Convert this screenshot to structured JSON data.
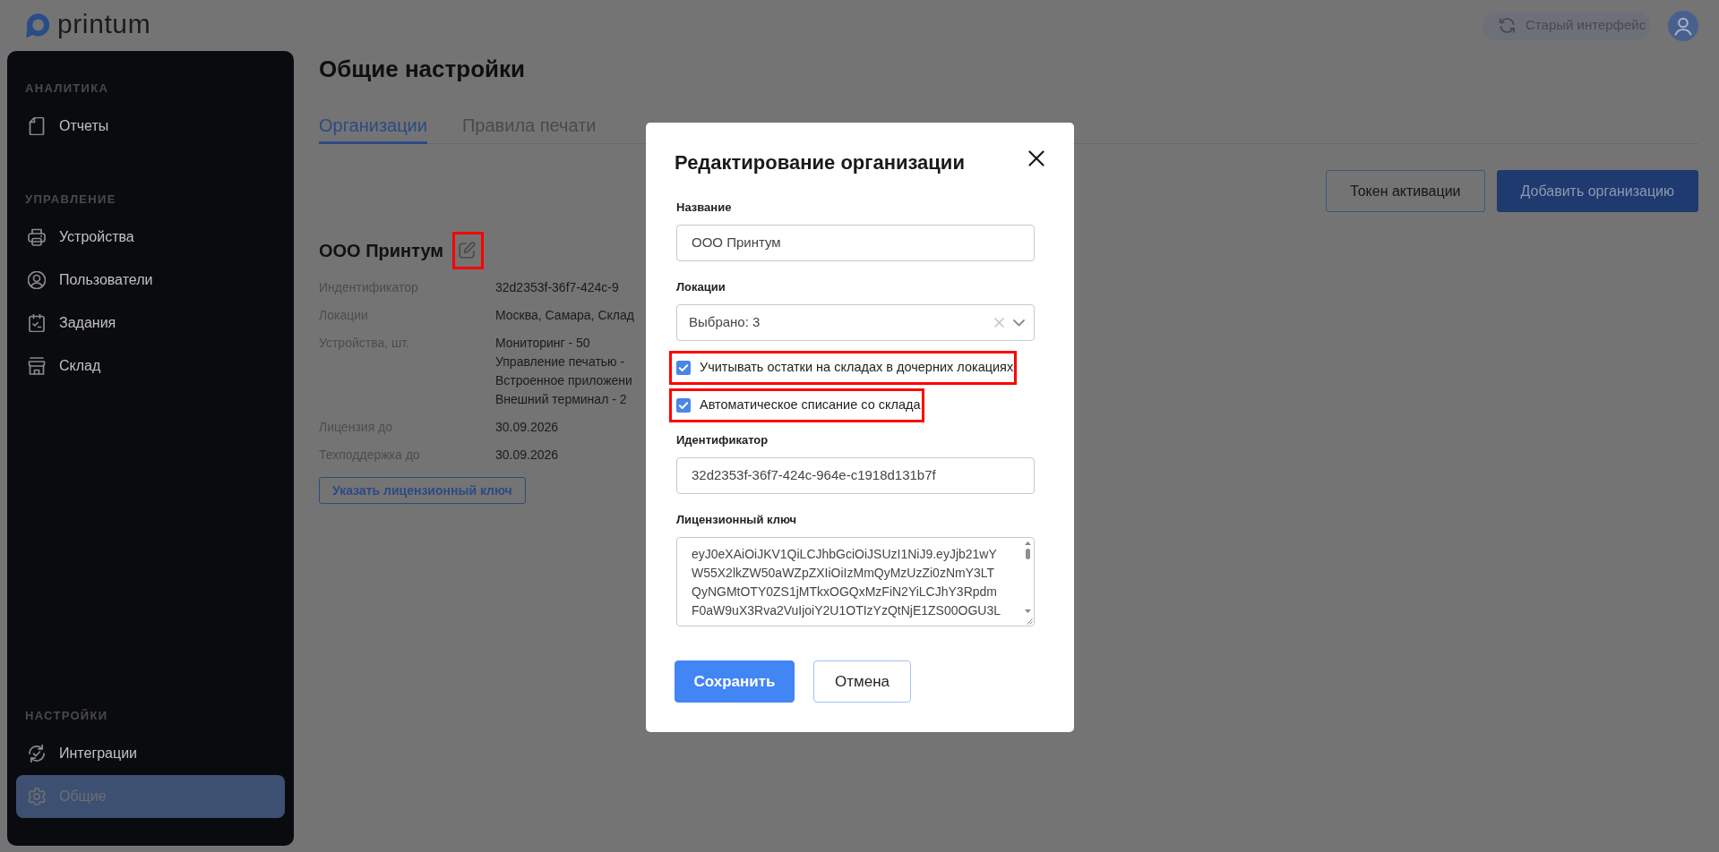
{
  "header": {
    "logo": "printum",
    "old_interface_button": "Старый интерфейс"
  },
  "sidebar": {
    "sections": [
      {
        "title": "АНАЛИТИКА",
        "items": [
          {
            "label": "Отчеты",
            "selected": false
          }
        ]
      },
      {
        "title": "УПРАВЛЕНИЕ",
        "items": [
          {
            "label": "Устройства",
            "selected": false
          },
          {
            "label": "Пользователи",
            "selected": false
          },
          {
            "label": "Задания",
            "selected": false
          },
          {
            "label": "Склад",
            "selected": false
          }
        ]
      },
      {
        "title": "НАСТРОЙКИ",
        "items": [
          {
            "label": "Интеграции",
            "selected": false
          },
          {
            "label": "Общие",
            "selected": true
          }
        ]
      }
    ]
  },
  "page": {
    "title": "Общие настройки",
    "tabs": [
      {
        "label": "Организации",
        "selected": true
      },
      {
        "label": "Правила печати",
        "selected": false
      }
    ],
    "actions": [
      {
        "label": "Токен активации",
        "kind": "outline"
      },
      {
        "label": "Добавить организацию",
        "kind": "primary"
      }
    ],
    "organization": {
      "name": "ООО Принтум",
      "edit_highlighted": true,
      "fields": [
        {
          "label": "Индентификатор",
          "values": [
            "32d2353f-36f7-424c-9"
          ]
        },
        {
          "label": "Локации",
          "values": [
            "Москва, Самара, Склад"
          ]
        },
        {
          "label": "Устройства, шт.",
          "values": [
            "Мониторинг - 50",
            "Управление печатью -",
            "Встроенное приложени",
            "Внешний терминал - 2"
          ]
        },
        {
          "label": "Лицензия до",
          "values": [
            "30.09.2026"
          ]
        },
        {
          "label": "Техподдержка до",
          "values": [
            "30.09.2026"
          ]
        }
      ],
      "license_button": "Указать лицензионный ключ"
    }
  },
  "dialog": {
    "title": "Редактирование организации",
    "name_field": {
      "label": "Название",
      "value": "ООО Принтум"
    },
    "locations_field": {
      "label": "Локации",
      "value": "Выбрано: 3"
    },
    "checkboxes": [
      {
        "label": "Учитывать остатки на складах в дочерних локациях",
        "checked": true,
        "highlighted": true
      },
      {
        "label": "Автоматическое списание со склада",
        "checked": true,
        "highlighted": true
      }
    ],
    "identifier_field": {
      "label": "Идентификатор",
      "value": "32d2353f-36f7-424c-964e-c1918d131b7f"
    },
    "license_field": {
      "label": "Лицензионный ключ",
      "value_lines": [
        "eyJ0eXAiOiJKV1QiLCJhbGciOiJSUzI1NiJ9.eyJjb21wY",
        "W55X2lkZW50aWZpZXIiOiIzMmQyMzUzZi0zNmY3LT",
        "QyNGMtOTY0ZS1jMTkxOGQxMzFiN2YiLCJhY3Rpdm",
        "F0aW9uX3Rva2VuIjoiY2U1OTIzYzQtNjE1ZS00OGU3L"
      ]
    },
    "buttons": [
      {
        "label": "Сохранить",
        "kind": "primary"
      },
      {
        "label": "Отмена",
        "kind": "secondary"
      }
    ]
  }
}
